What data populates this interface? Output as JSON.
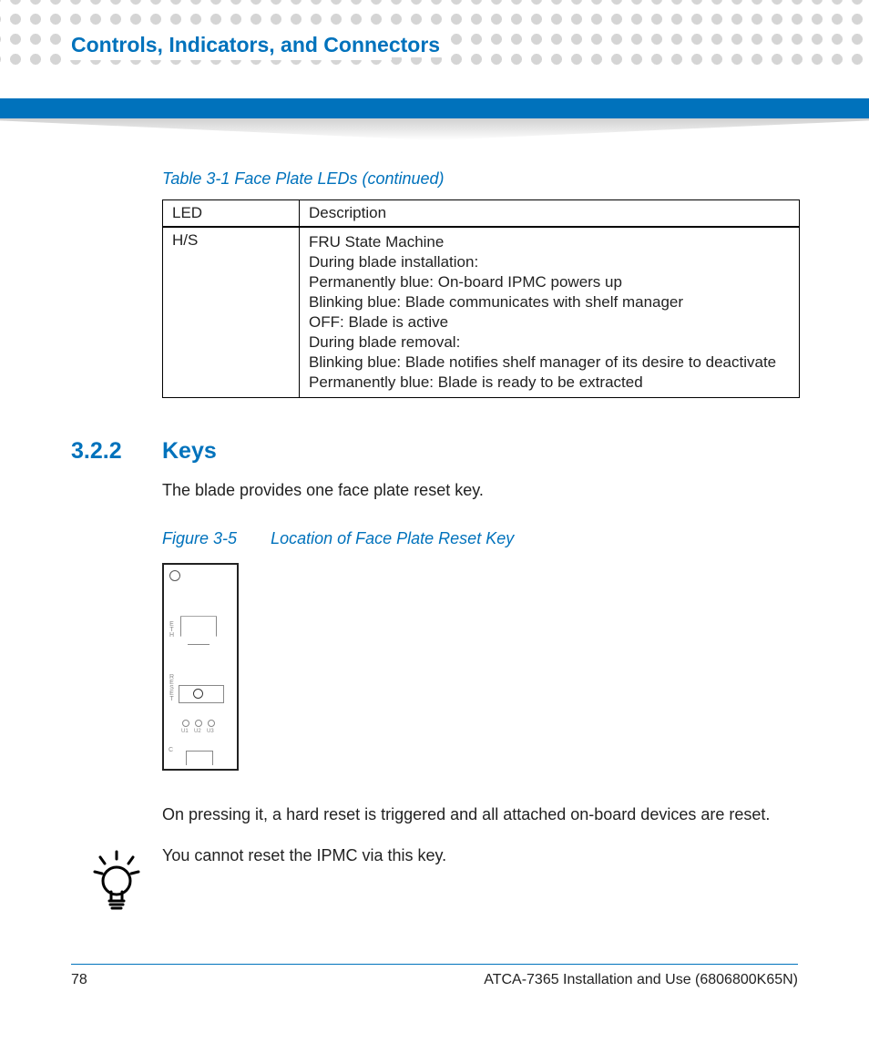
{
  "header": {
    "chapter_title": "Controls, Indicators, and Connectors"
  },
  "table": {
    "caption": "Table 3-1 Face Plate LEDs (continued)",
    "col_led": "LED",
    "col_desc": "Description",
    "row": {
      "led": "H/S",
      "lines": [
        "FRU State Machine",
        "During blade installation:",
        "Permanently blue: On-board IPMC powers up",
        "Blinking blue: Blade communicates with shelf manager",
        "OFF: Blade is active",
        "During blade removal:",
        "Blinking blue: Blade notifies shelf manager of its desire to deactivate",
        "Permanently blue: Blade is ready to be extracted"
      ]
    }
  },
  "section": {
    "number": "3.2.2",
    "title": "Keys",
    "intro": "The blade provides one face plate reset key."
  },
  "figure": {
    "num": "Figure 3-5",
    "title": "Location of Face Plate Reset Key",
    "labels": {
      "eth": "ETH",
      "reset": "RESET",
      "u1": "U1",
      "u2": "U2",
      "u3": "U3",
      "c": "C"
    }
  },
  "after_figure": "On pressing it, a hard reset is triggered and all attached on-board devices are reset.",
  "tip": "You cannot reset the IPMC via this key.",
  "footer": {
    "page": "78",
    "doc": "ATCA-7365 Installation and Use (6806800K65N)"
  }
}
